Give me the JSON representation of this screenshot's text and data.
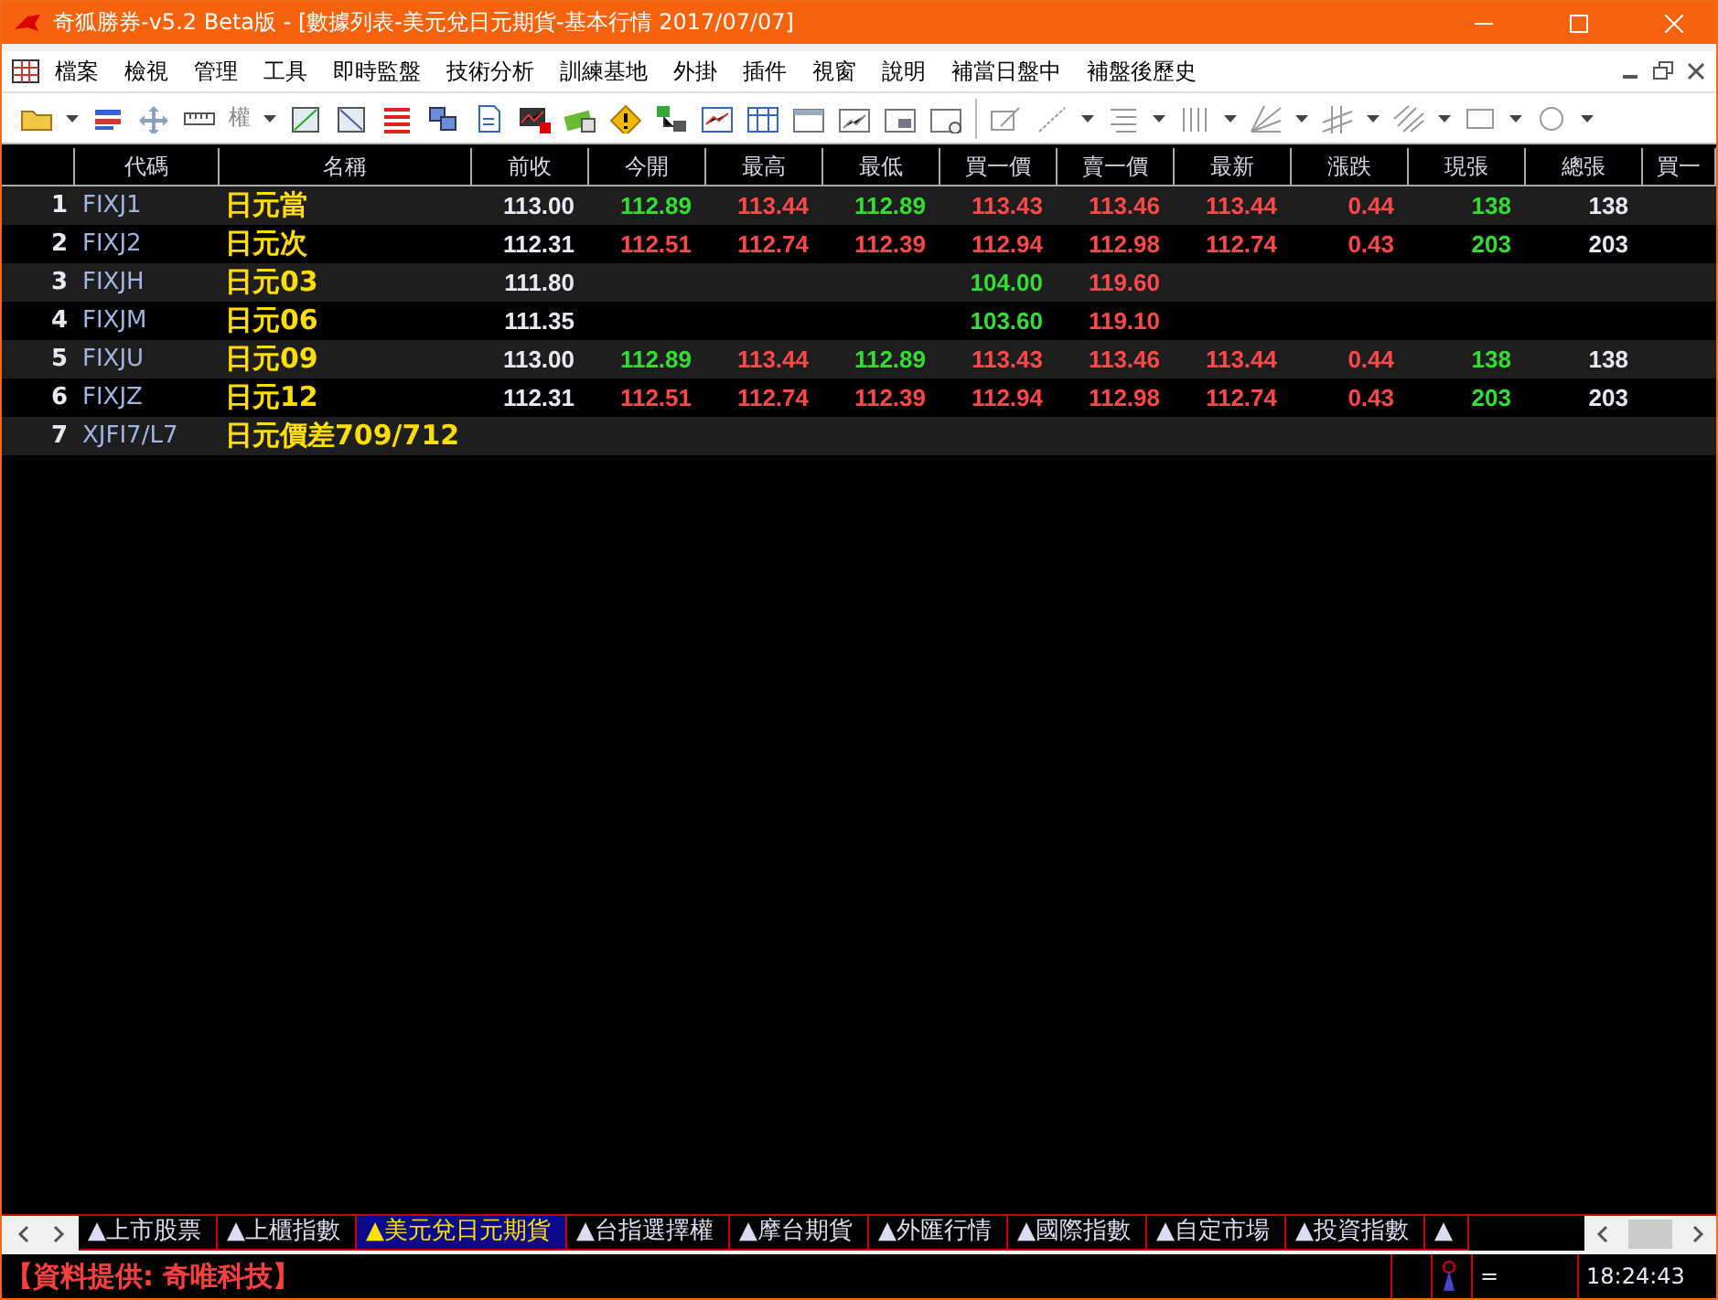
{
  "window": {
    "title": "奇狐勝券-v5.2 Beta版 - [數據列表-美元兌日元期貨-基本行情 2017/07/07]"
  },
  "menu": [
    "檔案",
    "檢視",
    "管理",
    "工具",
    "即時監盤",
    "技術分析",
    "訓練基地",
    "外掛",
    "插件",
    "視窗",
    "說明",
    "補當日盤中",
    "補盤後歷史"
  ],
  "toolbar": {
    "rights_label": "權"
  },
  "table": {
    "columns": [
      "",
      "代碼",
      "名稱",
      "前收",
      "今開",
      "最高",
      "最低",
      "買一價",
      "賣一價",
      "最新",
      "漲跌",
      "現張",
      "總張",
      "買一"
    ],
    "rows": [
      {
        "cells": [
          "1",
          "FIXJ1",
          "日元當",
          {
            "text": "113.00",
            "color": "#e8e8f0"
          },
          {
            "text": "112.89",
            "color": "#33dd33"
          },
          {
            "text": "113.44",
            "color": "#ff4848"
          },
          {
            "text": "112.89",
            "color": "#33dd33"
          },
          {
            "text": "113.43",
            "color": "#ff4848"
          },
          {
            "text": "113.46",
            "color": "#ff4848"
          },
          {
            "text": "113.44",
            "color": "#ff4848"
          },
          {
            "text": "0.44",
            "color": "#ff4848"
          },
          {
            "text": "138",
            "color": "#33dd33"
          },
          {
            "text": "138",
            "color": "#e8e8f0"
          }
        ]
      },
      {
        "cells": [
          "2",
          "FIXJ2",
          "日元次",
          {
            "text": "112.31",
            "color": "#e8e8f0"
          },
          {
            "text": "112.51",
            "color": "#ff4848"
          },
          {
            "text": "112.74",
            "color": "#ff4848"
          },
          {
            "text": "112.39",
            "color": "#ff4848"
          },
          {
            "text": "112.94",
            "color": "#ff4848"
          },
          {
            "text": "112.98",
            "color": "#ff4848"
          },
          {
            "text": "112.74",
            "color": "#ff4848"
          },
          {
            "text": "0.43",
            "color": "#ff4848"
          },
          {
            "text": "203",
            "color": "#33dd33"
          },
          {
            "text": "203",
            "color": "#e8e8f0"
          }
        ]
      },
      {
        "cells": [
          "3",
          "FIXJH",
          "日元03",
          {
            "text": "111.80",
            "color": "#e8e8f0"
          },
          null,
          null,
          null,
          {
            "text": "104.00",
            "color": "#33dd33"
          },
          {
            "text": "119.60",
            "color": "#ff4848"
          },
          null,
          null,
          null,
          null
        ]
      },
      {
        "cells": [
          "4",
          "FIXJM",
          "日元06",
          {
            "text": "111.35",
            "color": "#e8e8f0"
          },
          null,
          null,
          null,
          {
            "text": "103.60",
            "color": "#33dd33"
          },
          {
            "text": "119.10",
            "color": "#ff4848"
          },
          null,
          null,
          null,
          null
        ]
      },
      {
        "cells": [
          "5",
          "FIXJU",
          "日元09",
          {
            "text": "113.00",
            "color": "#e8e8f0"
          },
          {
            "text": "112.89",
            "color": "#33dd33"
          },
          {
            "text": "113.44",
            "color": "#ff4848"
          },
          {
            "text": "112.89",
            "color": "#33dd33"
          },
          {
            "text": "113.43",
            "color": "#ff4848"
          },
          {
            "text": "113.46",
            "color": "#ff4848"
          },
          {
            "text": "113.44",
            "color": "#ff4848"
          },
          {
            "text": "0.44",
            "color": "#ff4848"
          },
          {
            "text": "138",
            "color": "#33dd33"
          },
          {
            "text": "138",
            "color": "#e8e8f0"
          }
        ]
      },
      {
        "cells": [
          "6",
          "FIXJZ",
          "日元12",
          {
            "text": "112.31",
            "color": "#e8e8f0"
          },
          {
            "text": "112.51",
            "color": "#ff4848"
          },
          {
            "text": "112.74",
            "color": "#ff4848"
          },
          {
            "text": "112.39",
            "color": "#ff4848"
          },
          {
            "text": "112.94",
            "color": "#ff4848"
          },
          {
            "text": "112.98",
            "color": "#ff4848"
          },
          {
            "text": "112.74",
            "color": "#ff4848"
          },
          {
            "text": "0.43",
            "color": "#ff4848"
          },
          {
            "text": "203",
            "color": "#33dd33"
          },
          {
            "text": "203",
            "color": "#e8e8f0"
          }
        ]
      },
      {
        "cells": [
          "7",
          "XJFI7/L7",
          "日元價差709/712",
          null,
          null,
          null,
          null,
          null,
          null,
          null,
          null,
          null,
          null
        ]
      }
    ]
  },
  "tabs": [
    {
      "label": "▲上市股票",
      "selected": false
    },
    {
      "label": "▲上櫃指數",
      "selected": false
    },
    {
      "label": "▲美元兌日元期貨",
      "selected": true
    },
    {
      "label": "▲台指選擇權",
      "selected": false
    },
    {
      "label": "▲摩台期貨",
      "selected": false
    },
    {
      "label": "▲外匯行情",
      "selected": false
    },
    {
      "label": "▲國際指數",
      "selected": false
    },
    {
      "label": "▲自定市場",
      "selected": false
    },
    {
      "label": "▲投資指數",
      "selected": false
    },
    {
      "label": "▲",
      "selected": false
    }
  ],
  "status_bar": {
    "provider": "【資料提供: 奇唯科技】",
    "indicator": "=",
    "time": "18:24:43"
  }
}
